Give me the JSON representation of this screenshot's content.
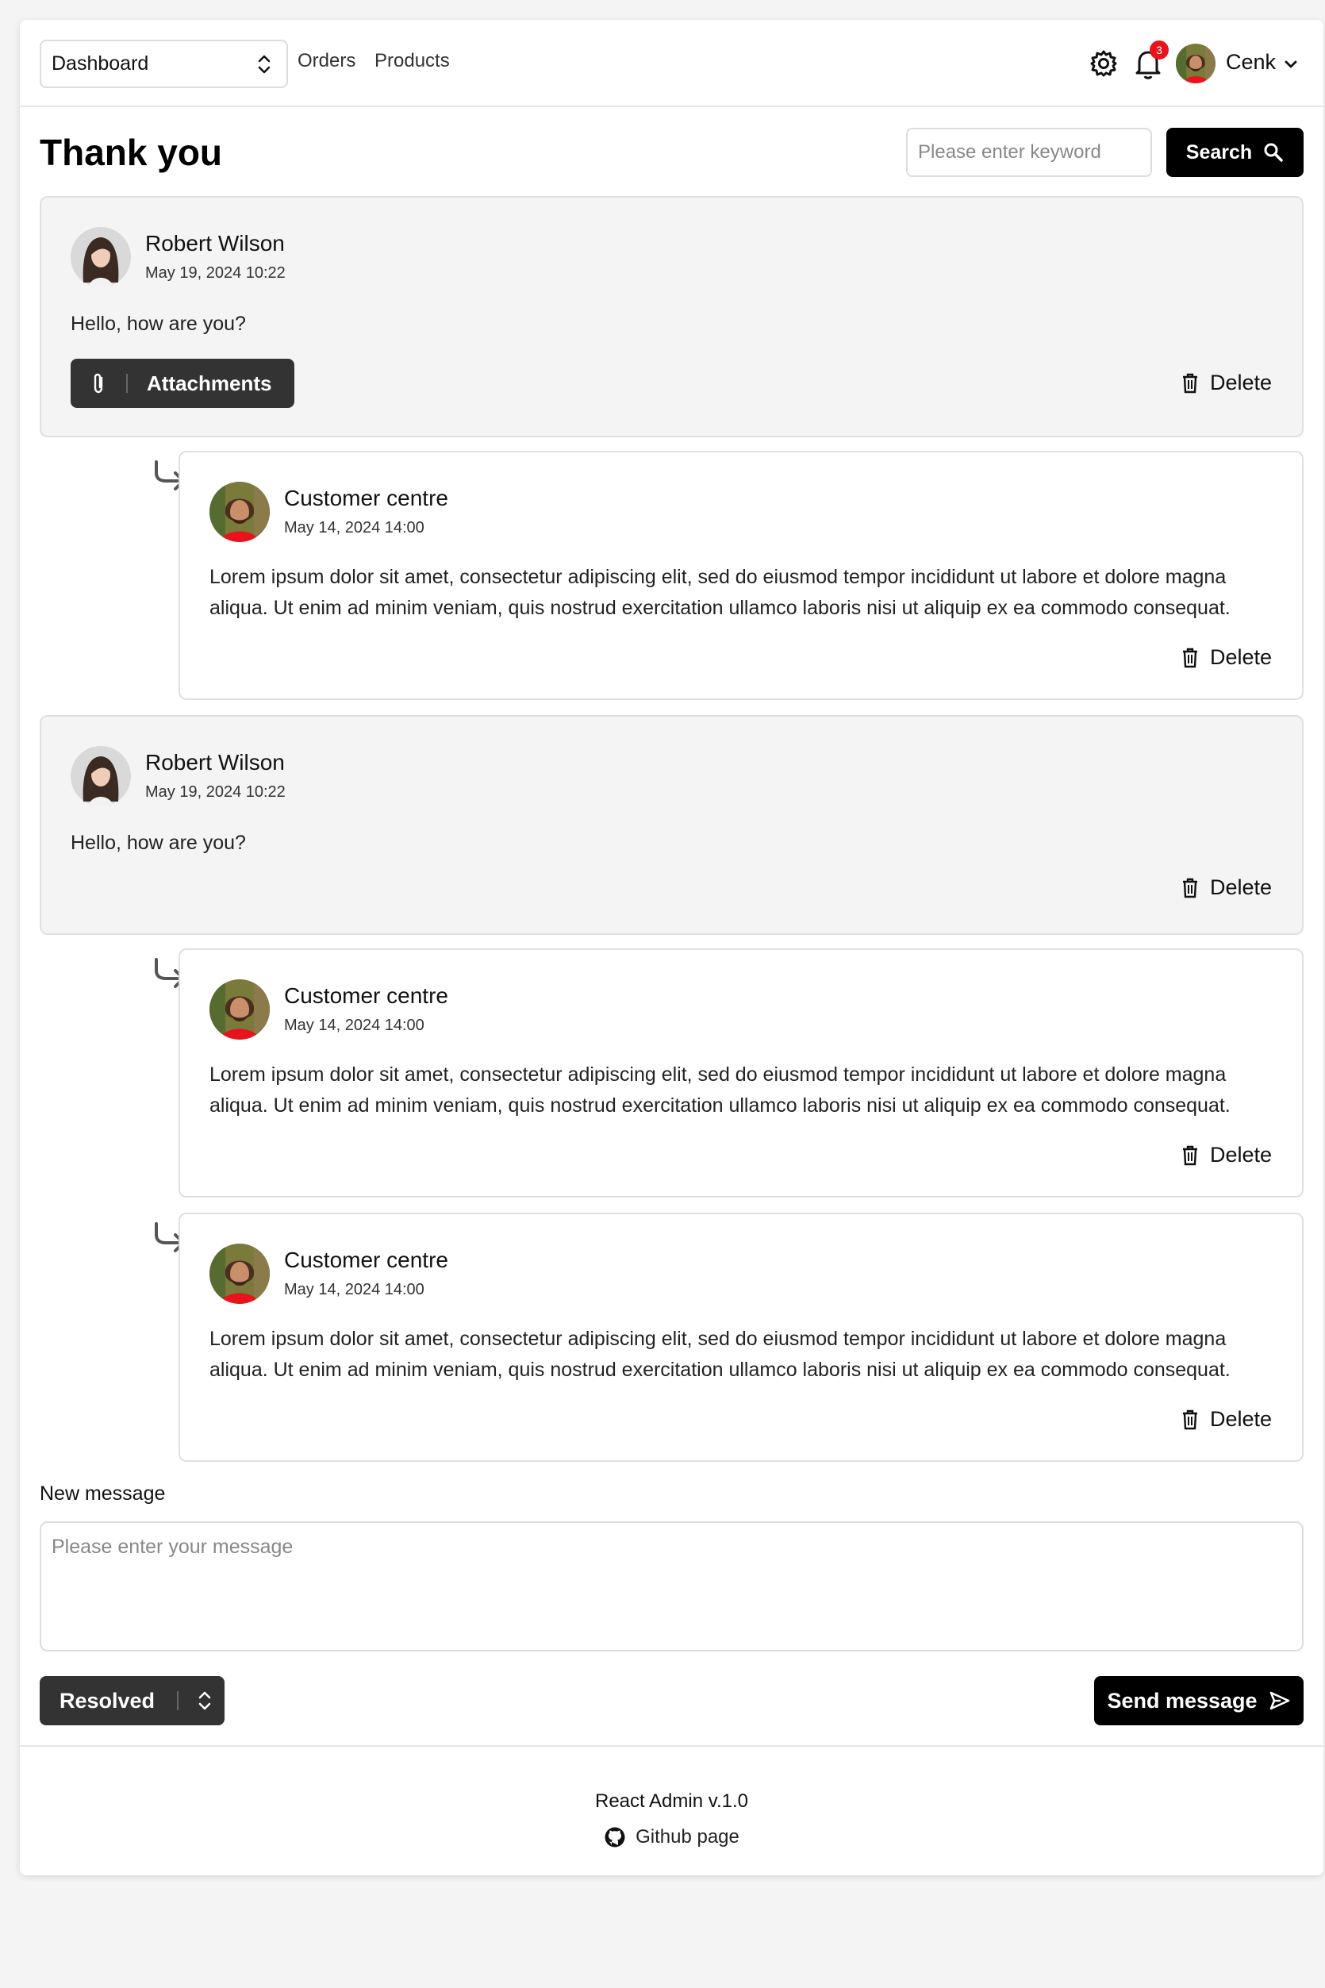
{
  "header": {
    "dashboard_select": "Dashboard",
    "nav": [
      "Orders",
      "Products"
    ],
    "notification_count": "3",
    "user_name": "Cenk",
    "icons": {
      "settings": "gear-icon",
      "notifications": "bell-icon",
      "menu": "chevron-down-icon"
    }
  },
  "page": {
    "title": "Thank you",
    "search_placeholder": "Please enter keyword",
    "search_label": "Search"
  },
  "messages": [
    {
      "author": "Robert Wilson",
      "date": "May 19, 2024 10:22",
      "text": "Hello, how are you?",
      "attachments_label": "Attachments",
      "delete_label": "Delete"
    },
    {
      "author": "Customer centre",
      "date": "May 14, 2024 14:00",
      "text": "Lorem ipsum dolor sit amet, consectetur adipiscing elit, sed do eiusmod tempor incididunt ut labore et dolore magna aliqua. Ut enim ad minim veniam, quis nostrud exercitation ullamco laboris nisi ut aliquip ex ea commodo consequat.",
      "delete_label": "Delete"
    },
    {
      "author": "Robert Wilson",
      "date": "May 19, 2024 10:22",
      "text": "Hello, how are you?",
      "delete_label": "Delete"
    },
    {
      "author": "Customer centre",
      "date": "May 14, 2024 14:00",
      "text": "Lorem ipsum dolor sit amet, consectetur adipiscing elit, sed do eiusmod tempor incididunt ut labore et dolore magna aliqua. Ut enim ad minim veniam, quis nostrud exercitation ullamco laboris nisi ut aliquip ex ea commodo consequat.",
      "delete_label": "Delete"
    },
    {
      "author": "Customer centre",
      "date": "May 14, 2024 14:00",
      "text": "Lorem ipsum dolor sit amet, consectetur adipiscing elit, sed do eiusmod tempor incididunt ut labore et dolore magna aliqua. Ut enim ad minim veniam, quis nostrud exercitation ullamco laboris nisi ut aliquip ex ea commodo consequat.",
      "delete_label": "Delete"
    }
  ],
  "compose": {
    "label": "New message",
    "placeholder": "Please enter your message",
    "status": "Resolved",
    "send_label": "Send message"
  },
  "footer": {
    "title": "React Admin v.1.0",
    "github_label": "Github page"
  },
  "colors": {
    "primary": "#000000",
    "secondary": "#333333",
    "badge": "#e8131c",
    "card_grey": "#f4f4f4"
  }
}
